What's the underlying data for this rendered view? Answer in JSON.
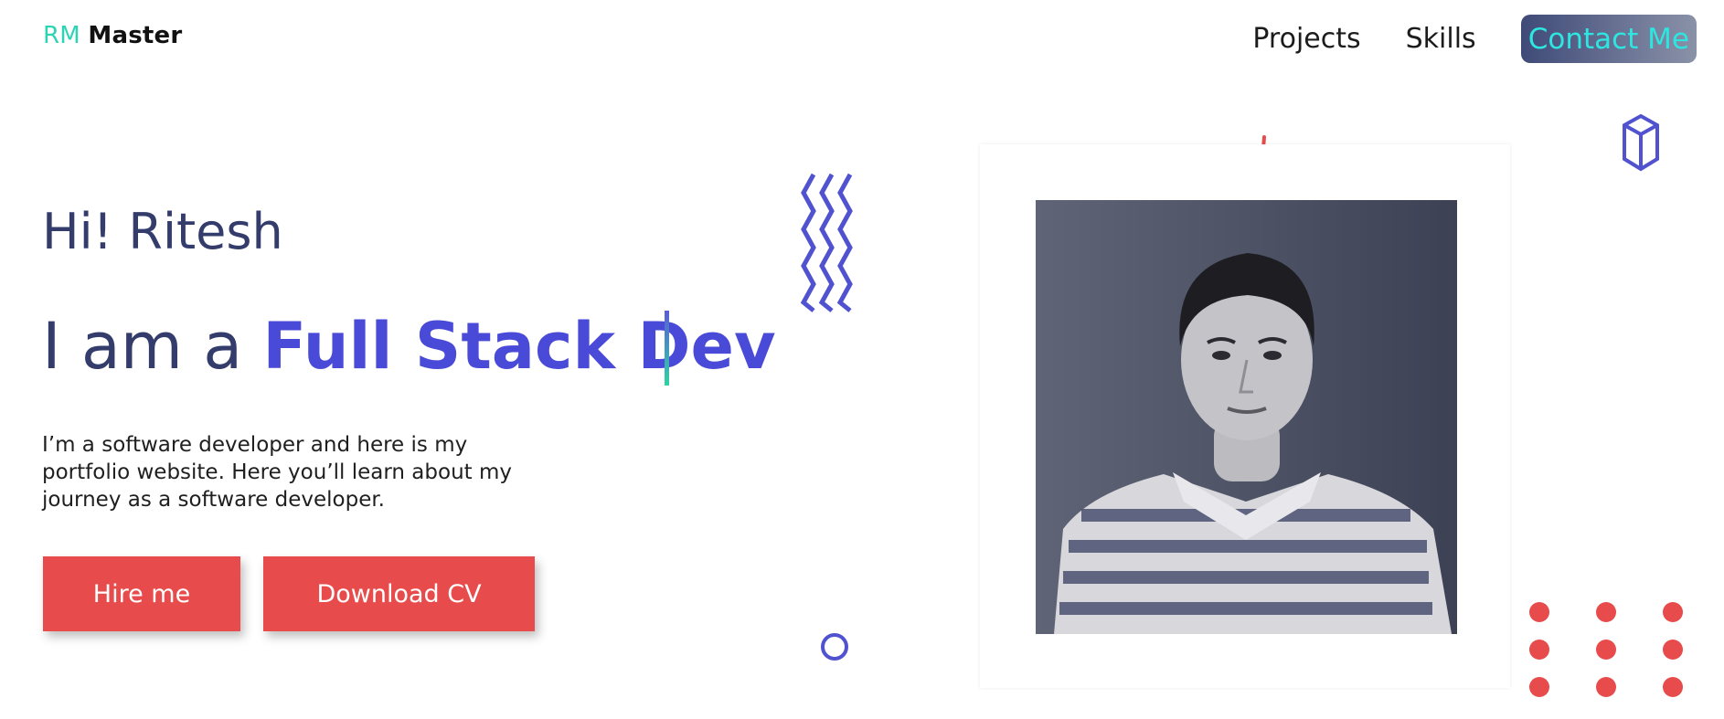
{
  "header": {
    "logo_prefix": "RM",
    "logo_name": "Master",
    "nav": {
      "projects_label": "Projects",
      "skills_label": "Skills",
      "contact_label": "Contact Me"
    }
  },
  "hero": {
    "greeting": "Hi! Ritesh",
    "headline_prefix": "I am a ",
    "headline_role": "Full Stack Dev",
    "intro": "I’m a software developer and here is my portfolio website. Here you’ll learn about my journey as a software developer.",
    "hire_label": "Hire me",
    "cv_label": "Download CV"
  },
  "colors": {
    "accent_teal": "#2dd4b4",
    "accent_indigo": "#4a4ad8",
    "heading_navy": "#333c6b",
    "button_red": "#e84b4b",
    "contact_text": "#2ee6e0"
  },
  "icons": [
    "zigzag-icon",
    "plus-icon",
    "box-icon",
    "ring-icon",
    "dot-grid-icon"
  ]
}
